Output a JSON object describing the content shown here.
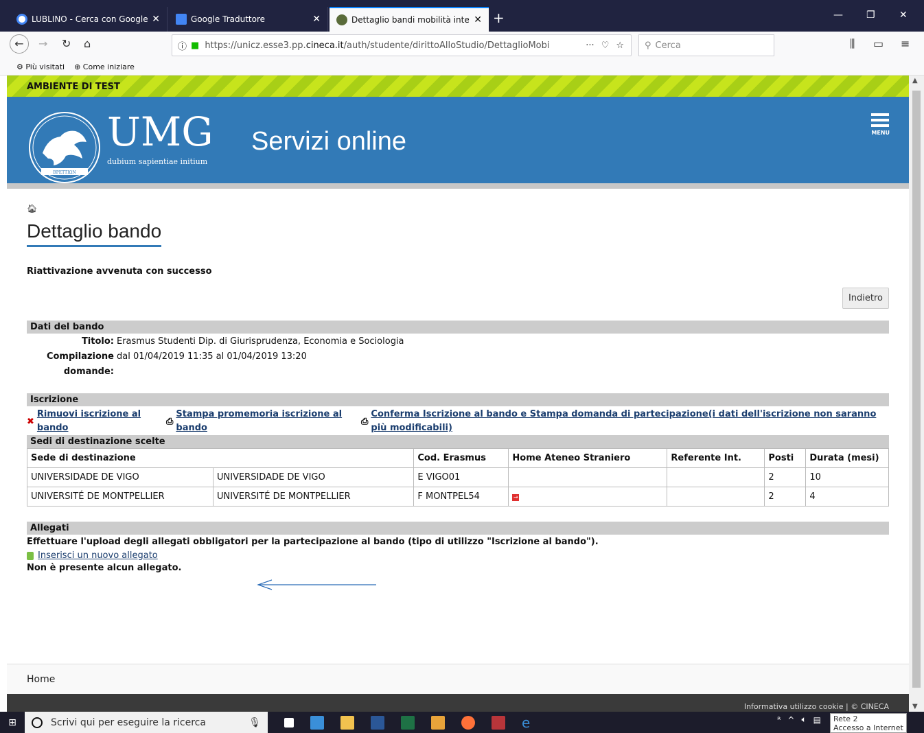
{
  "browser": {
    "tabs": [
      {
        "title": "LUBLINO - Cerca con Google",
        "icon": "google-icon"
      },
      {
        "title": "Google Traduttore",
        "icon": "translate-icon"
      },
      {
        "title": "Dettaglio bandi mobilità interna",
        "icon": "site-icon"
      }
    ],
    "new_tab": "+",
    "url_prefix": "https://unicz.esse3.pp.",
    "url_domain": "cineca.it",
    "url_path": "/auth/studente/dirittoAlloStudio/DettaglioMobi",
    "url_actions": "···",
    "search_placeholder": "Cerca",
    "bookmarks": [
      {
        "label": "Più visitati",
        "icon": "gear-icon"
      },
      {
        "label": "Come iniziare",
        "icon": "globe-icon"
      }
    ]
  },
  "page": {
    "test_banner": "AMBIENTE DI TEST",
    "logo_text": "UMG",
    "logo_motto": "dubium sapientiae initium",
    "logo_seal_text": "ΒΡΕΤΤΙΩΝ",
    "site_title": "Servizi online",
    "menu_label": "MENU",
    "page_title": "Dettaglio bando",
    "success_message": "Riattivazione avvenuta con successo",
    "back_button": "Indietro",
    "dati_bando": {
      "section": "Dati del bando",
      "titolo_label": "Titolo:",
      "titolo_value": "Erasmus Studenti Dip. di Giurisprudenza, Economia e Sociologia",
      "compilazione_label_1": "Compilazione",
      "compilazione_label_2": "domande:",
      "compilazione_value": "dal 01/04/2019 11:35 al 01/04/2019 13:20"
    },
    "iscrizione": {
      "section": "Iscrizione",
      "links": [
        {
          "line1": "Rimuovi iscrizione al",
          "line2": "bando"
        },
        {
          "line1": "Stampa promemoria iscrizione al",
          "line2": "bando"
        },
        {
          "line1": "Conferma Iscrizione al bando e Stampa domanda di partecipazione(i dati dell'iscrizione non saranno",
          "line2": "più modificabili)"
        }
      ]
    },
    "sedi": {
      "section": "Sedi di destinazione scelte",
      "headers": [
        "Sede di destinazione",
        "Cod. Erasmus",
        "Home Ateneo Straniero",
        "Referente Int.",
        "Posti",
        "Durata (mesi)"
      ],
      "rows": [
        {
          "sede1": "UNIVERSIDADE DE VIGO",
          "sede2": "UNIVERSIDADE DE VIGO",
          "cod": "E VIGO01",
          "home": "",
          "referente": "",
          "posti": "2",
          "durata": "10"
        },
        {
          "sede1": "UNIVERSITÉ DE MONTPELLIER",
          "sede2": "UNIVERSITÉ DE MONTPELLIER",
          "cod": "F MONTPEL54",
          "home": "→",
          "referente": "",
          "posti": "2",
          "durata": "4"
        }
      ]
    },
    "allegati": {
      "section": "Allegati",
      "instruction": "Effettuare l'upload degli allegati obbligatori per la partecipazione al bando (tipo di utilizzo \"Iscrizione al bando\").",
      "add_link": "Inserisci un nuovo allegato",
      "empty": "Non è presente alcun allegato."
    },
    "footer_home": "Home",
    "footer_info": "Informativa utilizzo cookie | © CINECA"
  },
  "taskbar": {
    "search_placeholder": "Scrivi qui per eseguire la ricerca",
    "apps": [
      "task-view-icon",
      "store-icon",
      "explorer-icon",
      "word-icon",
      "excel-icon",
      "outlook-icon",
      "firefox-icon",
      "app-icon",
      "ie-icon"
    ],
    "tooltip_line1": "Rete  2",
    "tooltip_line2": "Accesso a Internet"
  },
  "colors": {
    "header_blue": "#327ab7",
    "test_green": "#c7e41c",
    "link": "#1a3d6e",
    "section_gray": "#cccccc"
  }
}
